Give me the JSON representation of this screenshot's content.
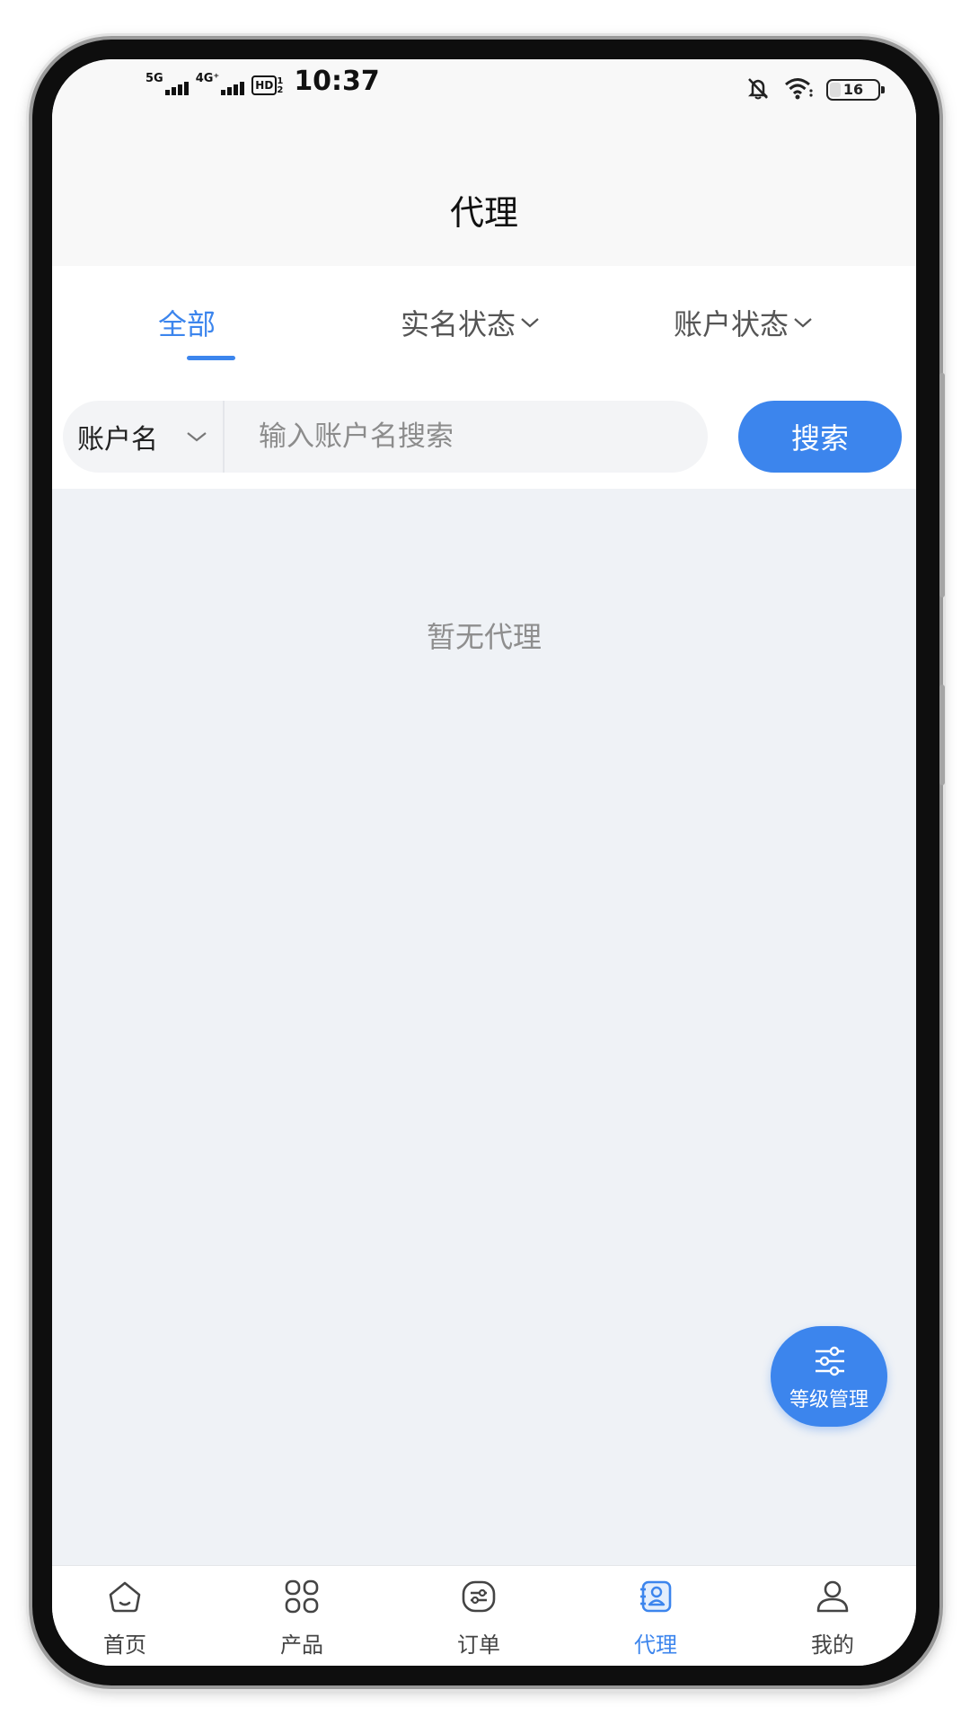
{
  "status_bar": {
    "network1": "5G",
    "network2": "4G⁺",
    "hd": "HD",
    "hd_sub1": "1",
    "hd_sub2": "2",
    "time": "10:37",
    "battery": "16"
  },
  "header": {
    "title": "代理"
  },
  "tabs": [
    {
      "label": "全部",
      "active": true
    },
    {
      "label": "实名状态",
      "active": false
    },
    {
      "label": "账户状态",
      "active": false
    }
  ],
  "search": {
    "field_label": "账户名",
    "placeholder": "输入账户名搜索",
    "value": "",
    "button_label": "搜索"
  },
  "content": {
    "empty_text": "暂无代理"
  },
  "fab": {
    "label": "等级管理",
    "icon": "sliders-icon"
  },
  "bottom_nav": [
    {
      "label": "首页",
      "icon": "home-icon",
      "active": false
    },
    {
      "label": "产品",
      "icon": "grid-icon",
      "active": false
    },
    {
      "label": "订单",
      "icon": "order-icon",
      "active": false
    },
    {
      "label": "代理",
      "icon": "agent-icon",
      "active": true
    },
    {
      "label": "我的",
      "icon": "user-icon",
      "active": false
    }
  ],
  "colors": {
    "accent": "#3c85ed",
    "background": "#eff2f6"
  }
}
